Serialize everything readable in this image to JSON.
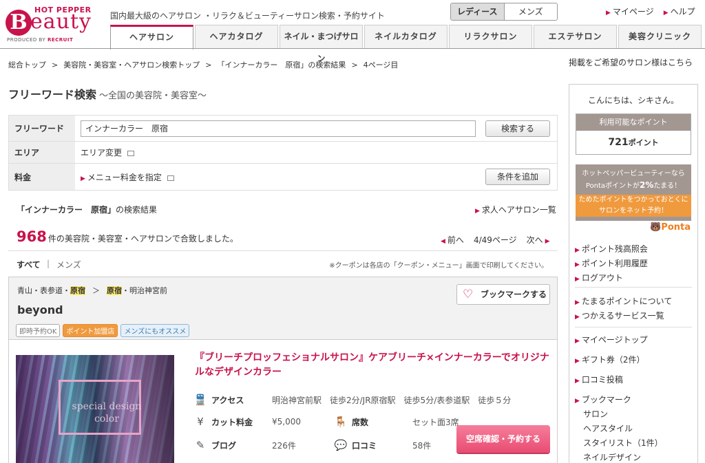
{
  "header": {
    "logo_top": "HOT PEPPER",
    "logo_b": "B",
    "logo_rest": "eauty",
    "logo_produced": "PRODUCED BY",
    "logo_recruit": "RECRUIT",
    "tagline": "国内最大級のヘアサロン ・リラク＆ビューティーサロン検索・予約サイト",
    "gender": [
      "レディース",
      "メンズ"
    ],
    "links": [
      "マイページ",
      "ヘルプ"
    ],
    "tabs": [
      "ヘアサロン",
      "ヘアカタログ",
      "ネイル・まつげサロン",
      "ネイルカタログ",
      "リラクサロン",
      "エステサロン",
      "美容クリニック"
    ]
  },
  "breadcrumb": [
    "総合トップ",
    "美容院・美容室・ヘアサロン検索トップ",
    "「インナーカラー　原宿」の検索結果",
    "4ページ目"
  ],
  "breadcrumb_sep": ">",
  "listing_link": "掲載をご希望のサロン様はこちら",
  "search": {
    "title": "フリーワード検索",
    "subtitle": "～全国の美容院・美容室～",
    "freeword_label": "フリーワード",
    "freeword_value": "インナーカラー　原宿",
    "search_button": "検索する",
    "area_label": "エリア",
    "area_link": "エリア変更",
    "price_label": "料金",
    "price_link": "メニュー料金を指定",
    "add_button": "条件を追加"
  },
  "results": {
    "query": "「インナーカラー　原宿」",
    "suffix": "の検索結果",
    "jobs_link": "求人ヘアサロン一覧",
    "count": "968",
    "count_text": "件の美容院・美容室・ヘアサロンで合致しました。",
    "prev": "前へ",
    "page": "4/49ページ",
    "next": "次へ",
    "filter_all": "すべて",
    "filter_bar": "|",
    "filter_men": "メンズ",
    "coupon_note": "※クーポンは各店の「クーポン・メニュー」画面で印刷してください。"
  },
  "salon": {
    "area": [
      "青山・表参道・",
      "原宿",
      "＞",
      "原宿",
      "・明治神宮前"
    ],
    "name": "beyond",
    "badges": [
      "即時予約OK",
      "ポイント加盟店",
      "メンズにもオススメ"
    ],
    "bookmark": "ブックマークする",
    "photo_text": "special design color",
    "catch": "『ブリーチプロッフェショナルサロン』ケアブリーチ×インナーカラーでオリジナルなデザインカラー",
    "access_label": "アクセス",
    "access": "明治神宮前駅　徒歩2分/JR原宿駅　徒歩5分/表参道駅　徒歩５分",
    "price_label": "カット料金",
    "price": "¥5,000",
    "seats_label": "席数",
    "seats": "セット面3席",
    "blog_label": "ブログ",
    "blog": "226件",
    "review_label": "口コミ",
    "review": "58件",
    "reserve": "空席確認・予約する"
  },
  "sidebar": {
    "greeting": "こんにちは、シキさん。",
    "points_label": "利用可能なポイント",
    "points_value": "721",
    "points_unit": "ポイント",
    "ponta_line1": "ホットペッパービューティーなら",
    "ponta_line2a": "Pontaポイントが",
    "ponta_pct": "2%",
    "ponta_line2b": "たまる！",
    "ponta_line3": "ためたポイントをつかっておとくにサロンをネット予約！",
    "ponta_logo": "Ponta",
    "list1": [
      "ポイント残高照会",
      "ポイント利用履歴",
      "ログアウト"
    ],
    "list2": [
      "たまるポイントについて",
      "つかえるサービス一覧"
    ],
    "list3": [
      "マイページトップ",
      "ギフト券（2件）",
      "口コミ投稿",
      "ブックマーク"
    ],
    "bookmark_sub": [
      "サロン",
      "ヘアスタイル",
      "スタイリスト（1件）",
      "ネイルデザイン"
    ]
  },
  "colors": {
    "brand": "#c8134b",
    "reserve": "#e94c73",
    "highlight": "#ffef6c"
  }
}
